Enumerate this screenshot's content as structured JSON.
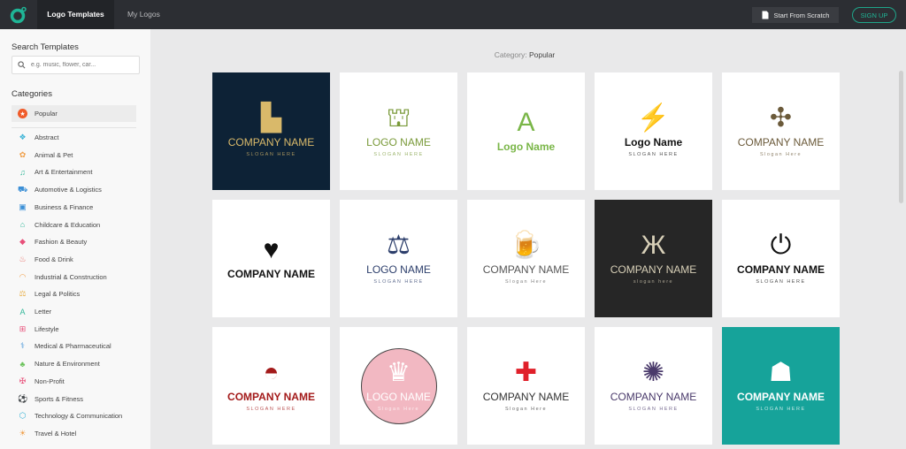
{
  "topbar": {
    "tabs": [
      {
        "label": "Logo Templates",
        "active": true
      },
      {
        "label": "My Logos",
        "active": false
      }
    ],
    "scratch_label": "Start From Scratch",
    "signup_label": "SIGN UP",
    "accent": "#1fb596"
  },
  "sidebar": {
    "search_title": "Search Templates",
    "search_placeholder": "e.g. music, flower, car...",
    "categories_title": "Categories",
    "popular": {
      "label": "Popular",
      "icon": "star-icon",
      "color": "#f05a28"
    },
    "categories": [
      {
        "label": "Abstract",
        "icon": "abstract-icon",
        "glyph": "❖",
        "color": "#3bb3d6"
      },
      {
        "label": "Animal & Pet",
        "icon": "paw-icon",
        "glyph": "✿",
        "color": "#f0a04b"
      },
      {
        "label": "Art & Entertainment",
        "icon": "music-icon",
        "glyph": "♫",
        "color": "#34b89a"
      },
      {
        "label": "Automotive & Logistics",
        "icon": "car-icon",
        "glyph": "⛟",
        "color": "#3b8fd6"
      },
      {
        "label": "Business & Finance",
        "icon": "briefcase-icon",
        "glyph": "▣",
        "color": "#3b8fd6"
      },
      {
        "label": "Childcare & Education",
        "icon": "graduation-cap-icon",
        "glyph": "⌂",
        "color": "#34b89a"
      },
      {
        "label": "Fashion & Beauty",
        "icon": "diamond-icon",
        "glyph": "◆",
        "color": "#e8507a"
      },
      {
        "label": "Food & Drink",
        "icon": "chef-hat-icon",
        "glyph": "♨",
        "color": "#e8706a"
      },
      {
        "label": "Industrial & Construction",
        "icon": "helmet-icon",
        "glyph": "◠",
        "color": "#f0a04b"
      },
      {
        "label": "Legal & Politics",
        "icon": "scales-icon",
        "glyph": "⚖",
        "color": "#e8b04b"
      },
      {
        "label": "Letter",
        "icon": "letter-a-icon",
        "glyph": "A",
        "color": "#34b89a"
      },
      {
        "label": "Lifestyle",
        "icon": "gift-icon",
        "glyph": "⊞",
        "color": "#e8507a"
      },
      {
        "label": "Medical & Pharmaceutical",
        "icon": "stethoscope-icon",
        "glyph": "⚕",
        "color": "#3b8fd6"
      },
      {
        "label": "Nature & Environment",
        "icon": "tree-icon",
        "glyph": "♣",
        "color": "#6ac25a"
      },
      {
        "label": "Non-Profit",
        "icon": "ribbon-icon",
        "glyph": "✠",
        "color": "#e8507a"
      },
      {
        "label": "Sports & Fitness",
        "icon": "soccer-ball-icon",
        "glyph": "⚽",
        "color": "#3b8fd6"
      },
      {
        "label": "Technology & Communication",
        "icon": "chip-icon",
        "glyph": "⬡",
        "color": "#3bb3d6"
      },
      {
        "label": "Travel & Hotel",
        "icon": "palm-tree-icon",
        "glyph": "☀",
        "color": "#f0a04b"
      }
    ]
  },
  "main": {
    "category_label": "Category:",
    "category_value": "Popular",
    "cards": [
      {
        "name": "COMPANY NAME",
        "slogan": "SLOGAN HERE",
        "bg": "#0d2236",
        "color": "#d9b96a",
        "icon": "building-icon",
        "glyph": "▙"
      },
      {
        "name": "LOGO NAME",
        "slogan": "SLOGAN HERE",
        "bg": "#ffffff",
        "color": "#7a9a3a",
        "icon": "capitol-laurel-icon",
        "glyph": "⛫"
      },
      {
        "name": "Logo Name",
        "slogan": "",
        "bg": "#ffffff",
        "color": "#7ab648",
        "icon": "letter-a-square-icon",
        "glyph": "A"
      },
      {
        "name": "Logo Name",
        "slogan": "SLOGAN HERE",
        "bg": "#ffffff",
        "color": "#111111",
        "icon": "lightning-circle-icon",
        "glyph": "⚡"
      },
      {
        "name": "COMPANY NAME",
        "slogan": "Slogan Here",
        "bg": "#ffffff",
        "color": "#6b5a3a",
        "icon": "windmill-icon",
        "glyph": "✣"
      },
      {
        "name": "COMPANY NAME",
        "slogan": "",
        "bg": "#ffffff",
        "color": "#111111",
        "icon": "phone-heart-icon",
        "glyph": "♥"
      },
      {
        "name": "LOGO NAME",
        "slogan": "SLOGAN HERE",
        "bg": "#ffffff",
        "color": "#2c3e6b",
        "icon": "shield-scales-icon",
        "glyph": "⚖"
      },
      {
        "name": "COMPANY NAME",
        "slogan": "Slogan Here",
        "bg": "#ffffff",
        "color": "#555555",
        "icon": "beer-shield-icon",
        "glyph": "🍺"
      },
      {
        "name": "COMPANY NAME",
        "slogan": "slogan here",
        "bg": "#262626",
        "color": "#d8d0b8",
        "icon": "butterfly-icon",
        "glyph": "Ж"
      },
      {
        "name": "COMPANY NAME",
        "slogan": "SLOGAN HERE",
        "bg": "#ffffff",
        "color": "#111111",
        "icon": "plug-leaf-icon",
        "glyph": "⏻"
      },
      {
        "name": "COMPANY NAME",
        "slogan": "SLOGAN HERE",
        "bg": "#ffffff",
        "color": "#a31a1a",
        "icon": "pizza-icon",
        "glyph": "◓"
      },
      {
        "name": "LOGO NAME",
        "slogan": "Slogan Here",
        "bg": "#ffffff",
        "color": "#ffffff",
        "icon": "cupcake-icon",
        "glyph": "♛"
      },
      {
        "name": "COMPANY NAME",
        "slogan": "Slogan Here",
        "bg": "#ffffff",
        "color": "#333333",
        "icon": "medical-cross-icon",
        "glyph": "✚"
      },
      {
        "name": "COMPANY NAME",
        "slogan": "SLOGAN HERE",
        "bg": "#ffffff",
        "color": "#4a3a6b",
        "icon": "candles-badge-icon",
        "glyph": "✺"
      },
      {
        "name": "COMPANY NAME",
        "slogan": "SLOGAN HERE",
        "bg": "#16a39a",
        "color": "#ffffff",
        "icon": "tooth-icon",
        "glyph": "☗"
      }
    ]
  }
}
